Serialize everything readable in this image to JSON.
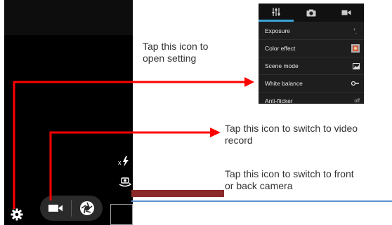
{
  "annotations": {
    "settings_caption": "Tap this icon to\nopen setting",
    "video_caption": "Tap this icon to switch to video\nrecord",
    "camera_caption": "Tap this icon to switch to front\nor back camera"
  },
  "camera": {
    "icons": [
      "flash-auto-icon",
      "switch-camera-icon",
      "gear-icon",
      "video-camera-icon",
      "shutter-icon"
    ]
  },
  "settings_popup": {
    "tabs": [
      "settings-tab",
      "camera-tab",
      "video-tab"
    ],
    "rows": [
      {
        "label": "Exposure",
        "value": ""
      },
      {
        "label": "Color effect",
        "value": ""
      },
      {
        "label": "Scene mode",
        "value": ""
      },
      {
        "label": "White balance",
        "value": ""
      },
      {
        "label": "Anti-flicker",
        "value": "off"
      }
    ]
  },
  "colors": {
    "arrow_red": "#ff0000",
    "divider_red": "#8b2a2a",
    "divider_blue": "#5b8fd0",
    "tab_accent": "#3aa4d8"
  }
}
